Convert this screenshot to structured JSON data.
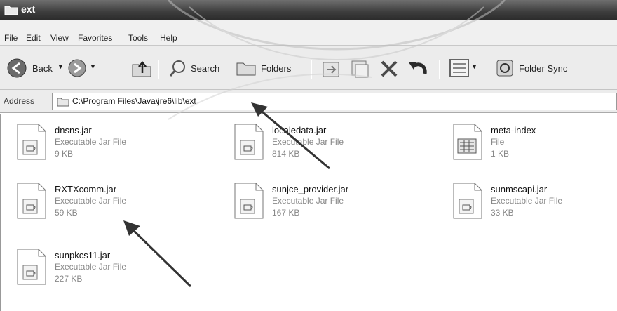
{
  "window": {
    "title": "ext"
  },
  "menu": [
    "File",
    "Edit",
    "View",
    "Favorites",
    "Tools",
    "Help"
  ],
  "toolbar": {
    "back_label": "Back",
    "search_label": "Search",
    "folders_label": "Folders",
    "folder_sync_label": "Folder Sync"
  },
  "address": {
    "label": "Address",
    "path": "C:\\Program Files\\Java\\jre6\\lib\\ext"
  },
  "files": [
    {
      "name": "dnsns.jar",
      "type": "Executable Jar File",
      "size": "9 KB",
      "icon": "jar-file-icon"
    },
    {
      "name": "localedata.jar",
      "type": "Executable Jar File",
      "size": "814 KB",
      "icon": "jar-file-icon"
    },
    {
      "name": "meta-index",
      "type": "File",
      "size": "1 KB",
      "icon": "generic-file-icon"
    },
    {
      "name": "RXTXcomm.jar",
      "type": "Executable Jar File",
      "size": "59 KB",
      "icon": "jar-file-icon"
    },
    {
      "name": "sunjce_provider.jar",
      "type": "Executable Jar File",
      "size": "167 KB",
      "icon": "jar-file-icon"
    },
    {
      "name": "sunmscapi.jar",
      "type": "Executable Jar File",
      "size": "33 KB",
      "icon": "jar-file-icon"
    },
    {
      "name": "sunpkcs11.jar",
      "type": "Executable Jar File",
      "size": "227 KB",
      "icon": "jar-file-icon"
    }
  ]
}
